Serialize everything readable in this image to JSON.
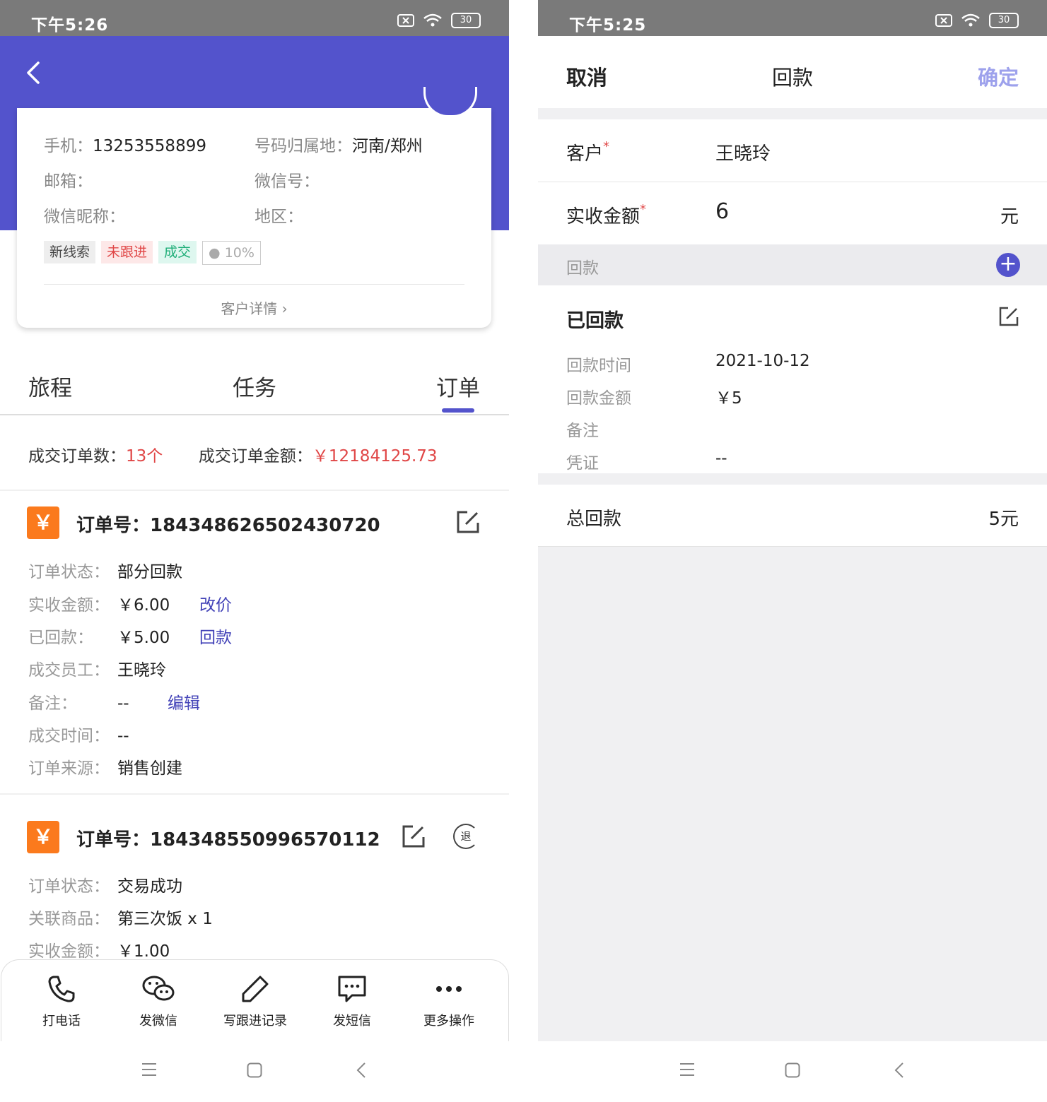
{
  "status": {
    "left_time": "下午5:26",
    "right_time": "下午5:25",
    "battery": "30"
  },
  "contact": {
    "phone_label": "手机：",
    "phone": "13253558899",
    "region_label": "号码归属地：",
    "region": "河南/郑州",
    "email_label": "邮箱：",
    "wechat_id_label": "微信号：",
    "wechat_nick_label": "微信昵称：",
    "area_label": "地区：",
    "tags": [
      "新线索",
      "未跟进",
      "成交",
      "10%"
    ],
    "detail_link": "客户详情"
  },
  "tabs": [
    "旅程",
    "任务",
    "订单"
  ],
  "summary": {
    "count_label": "成交订单数：",
    "count": "13个",
    "amount_label": "成交订单金额：",
    "amount": "￥12184125.73"
  },
  "orders": [
    {
      "icon": "￥",
      "number": "订单号：184348626502430720",
      "rows": [
        {
          "k": "订单状态：",
          "v": "部分回款"
        },
        {
          "k": "实收金额：",
          "v": "￥6.00",
          "link": "改价"
        },
        {
          "k": "已回款：",
          "v": "￥5.00",
          "link": "回款"
        },
        {
          "k": "成交员工：",
          "v": "王晓玲"
        },
        {
          "k": "备注：",
          "v": "--",
          "link": "编辑"
        },
        {
          "k": "成交时间：",
          "v": "--"
        },
        {
          "k": "订单来源：",
          "v": "销售创建"
        }
      ]
    },
    {
      "icon": "￥",
      "number": "订单号：184348550996570112",
      "refund_icon": "退",
      "rows": [
        {
          "k": "订单状态：",
          "v": "交易成功"
        },
        {
          "k": "关联商品：",
          "v": "第三次饭 x 1"
        },
        {
          "k": "实收金额：",
          "v": "￥1.00"
        }
      ]
    }
  ],
  "actions": [
    "打电话",
    "发微信",
    "写跟进记录",
    "发短信",
    "更多操作"
  ],
  "payment": {
    "cancel": "取消",
    "title": "回款",
    "confirm": "确定",
    "customer_label": "客户",
    "customer": "王晓玲",
    "received_label": "实收金额",
    "received": "6",
    "unit": "元",
    "section_label": "回款",
    "returned_title": "已回款",
    "rows": [
      {
        "k": "回款时间",
        "v": "2021-10-12"
      },
      {
        "k": "回款金额",
        "v": "￥5"
      },
      {
        "k": "备注",
        "v": ""
      },
      {
        "k": "凭证",
        "v": "--"
      }
    ],
    "total_label": "总回款",
    "total": "5元"
  },
  "colors": {
    "primary": "#5353cc",
    "accent_red": "#e04646",
    "order_icon": "#fb7a1d",
    "confirm": "#9da1ec"
  }
}
